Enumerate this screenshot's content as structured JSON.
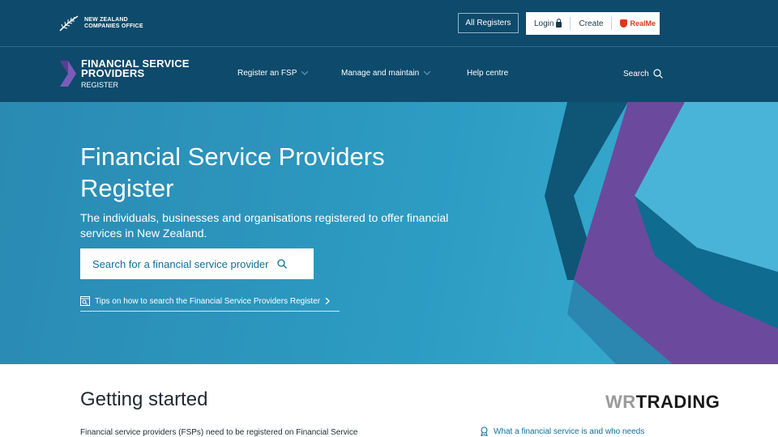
{
  "topbar": {
    "logo_line1": "NEW ZEALAND",
    "logo_line2": "COMPANIES OFFICE",
    "all_registers": "All Registers",
    "login": "Login",
    "create": "Create",
    "realme": "RealMe"
  },
  "nav": {
    "logo_line1": "FINANCIAL SERVICE",
    "logo_line2": "PROVIDERS",
    "logo_line3": "REGISTER",
    "items": [
      {
        "label": "Register an FSP"
      },
      {
        "label": "Manage and maintain"
      },
      {
        "label": "Help centre"
      }
    ],
    "search": "Search"
  },
  "hero": {
    "title": "Financial Service Providers Register",
    "subtitle": "The individuals, businesses and organisations registered to offer financial services in New Zealand.",
    "search_button": "Search for a financial service provider",
    "tips_link": "Tips on how to search the Financial Service Providers Register"
  },
  "content": {
    "heading": "Getting started",
    "intro": "Financial service providers (FSPs) need to be registered on Financial Service",
    "side_link": "What a financial service is and who needs",
    "watermark_wr": "WR",
    "watermark_trading": "TRADING"
  },
  "colors": {
    "header_bg": "#0e4a6b",
    "hero_bg": "#2d9cc3",
    "accent_purple": "#6b4a9e",
    "link": "#0e6f9c",
    "realme_red": "#d83a1c"
  }
}
